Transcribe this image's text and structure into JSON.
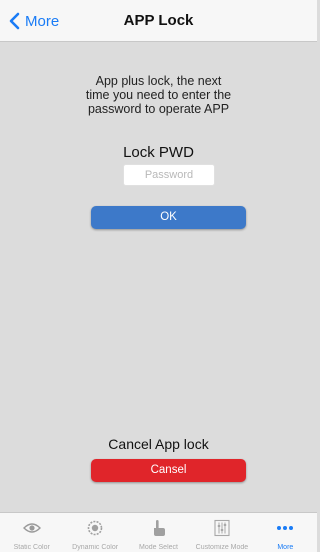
{
  "header": {
    "back_label": "More",
    "title": "APP Lock"
  },
  "lock": {
    "description_lines": [
      "App plus lock, the next",
      "time you need to enter the",
      "password to operate APP"
    ],
    "pwd_label": "Lock PWD",
    "password_placeholder": "Password",
    "password_value": "",
    "ok_label": "OK"
  },
  "cancel": {
    "label": "Cancel App lock",
    "button_label": "Cansel"
  },
  "tabbar": {
    "items": [
      {
        "label": "Static Color",
        "icon": "eye-icon"
      },
      {
        "label": "Dynamic Color",
        "icon": "flower-icon"
      },
      {
        "label": "Mode Select",
        "icon": "hand-pointer-icon"
      },
      {
        "label": "Customize Mode",
        "icon": "sliders-icon"
      },
      {
        "label": "More",
        "icon": "more-dots-icon"
      }
    ],
    "active_index": 4
  },
  "colors": {
    "accent": "#1a7cf6",
    "ok_button": "#3d79c9",
    "cancel_button": "#e0252a",
    "background": "#dcdcdc",
    "bar_background": "#f7f7f7"
  }
}
